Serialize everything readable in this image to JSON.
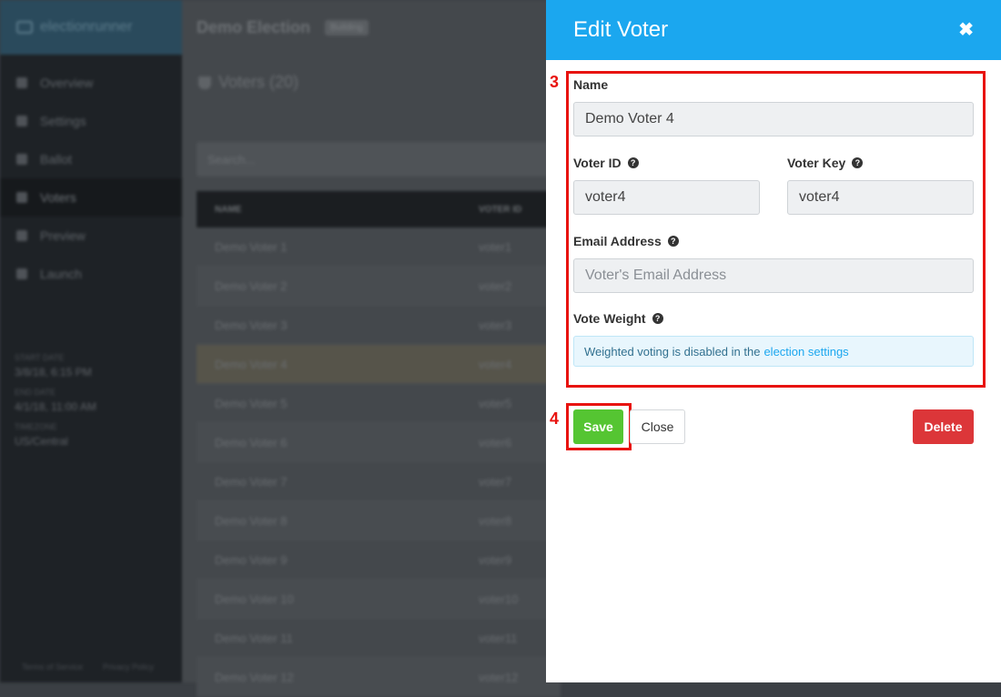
{
  "app": {
    "brand": "electionrunner"
  },
  "sidebar": {
    "items": [
      {
        "label": "Overview",
        "icon": "home-icon"
      },
      {
        "label": "Settings",
        "icon": "gear-icon"
      },
      {
        "label": "Ballot",
        "icon": "ballot-icon"
      },
      {
        "label": "Voters",
        "icon": "users-icon",
        "active": true
      },
      {
        "label": "Preview",
        "icon": "eye-icon"
      },
      {
        "label": "Launch",
        "icon": "rocket-icon"
      }
    ],
    "meta": {
      "start_label": "Start Date",
      "start_value": "3/8/18, 6:15 PM",
      "end_label": "End Date",
      "end_value": "4/1/18, 11:00 AM",
      "tz_label": "Timezone",
      "tz_value": "US/Central"
    },
    "footer": {
      "terms": "Terms of Service",
      "privacy": "Privacy Policy"
    }
  },
  "main": {
    "title": "Demo Election",
    "status": "Building",
    "voters_heading": "Voters (20)",
    "search_placeholder": "Search...",
    "table": {
      "headers": [
        "NAME",
        "VOTER ID"
      ],
      "rows": [
        [
          "Demo Voter 1",
          "voter1"
        ],
        [
          "Demo Voter 2",
          "voter2"
        ],
        [
          "Demo Voter 3",
          "voter3"
        ],
        [
          "Demo Voter 4",
          "voter4"
        ],
        [
          "Demo Voter 5",
          "voter5"
        ],
        [
          "Demo Voter 6",
          "voter6"
        ],
        [
          "Demo Voter 7",
          "voter7"
        ],
        [
          "Demo Voter 8",
          "voter8"
        ],
        [
          "Demo Voter 9",
          "voter9"
        ],
        [
          "Demo Voter 10",
          "voter10"
        ],
        [
          "Demo Voter 11",
          "voter11"
        ],
        [
          "Demo Voter 12",
          "voter12"
        ]
      ]
    }
  },
  "panel": {
    "title": "Edit Voter",
    "close_icon": "close-icon",
    "name_label": "Name",
    "name_value": "Demo Voter 4",
    "voter_id_label": "Voter ID",
    "voter_id_value": "voter4",
    "voter_key_label": "Voter Key",
    "voter_key_value": "voter4",
    "email_label": "Email Address",
    "email_placeholder": "Voter's Email Address",
    "vote_weight_label": "Vote Weight",
    "vote_weight_info": "Weighted voting is disabled in the",
    "vote_weight_link": "election settings",
    "save_label": "Save",
    "close_label": "Close",
    "delete_label": "Delete"
  },
  "callouts": {
    "fields": "3",
    "save": "4"
  },
  "colors": {
    "accent": "#1ba7ef",
    "save": "#55c532",
    "delete": "#dc3639",
    "callout": "#e8130f"
  }
}
